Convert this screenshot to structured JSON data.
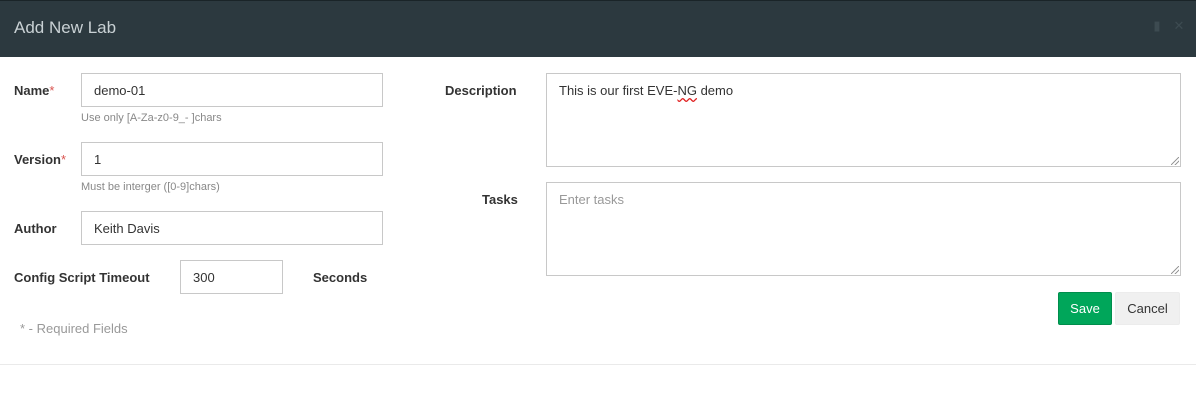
{
  "modal": {
    "title": "Add New Lab"
  },
  "form": {
    "name": {
      "label": "Name",
      "required_marker": "*",
      "value": "demo-01",
      "hint": "Use only [A-Za-z0-9_- ]chars"
    },
    "version": {
      "label": "Version",
      "required_marker": "*",
      "value": "1",
      "hint": "Must be interger ([0-9]chars)"
    },
    "author": {
      "label": "Author",
      "value": "Keith Davis"
    },
    "timeout": {
      "label": "Config Script Timeout",
      "value": "300",
      "unit": "Seconds"
    },
    "description": {
      "label": "Description",
      "value_prefix": "This is our first EVE-",
      "value_misspelled": "NG",
      "value_suffix": " demo"
    },
    "tasks": {
      "label": "Tasks",
      "placeholder": "Enter tasks"
    }
  },
  "buttons": {
    "save": "Save",
    "cancel": "Cancel"
  },
  "required_note": "* - Required Fields",
  "colors": {
    "header_bg": "#2c393f",
    "save_bg": "#00a65a",
    "required": "#d9534f"
  }
}
